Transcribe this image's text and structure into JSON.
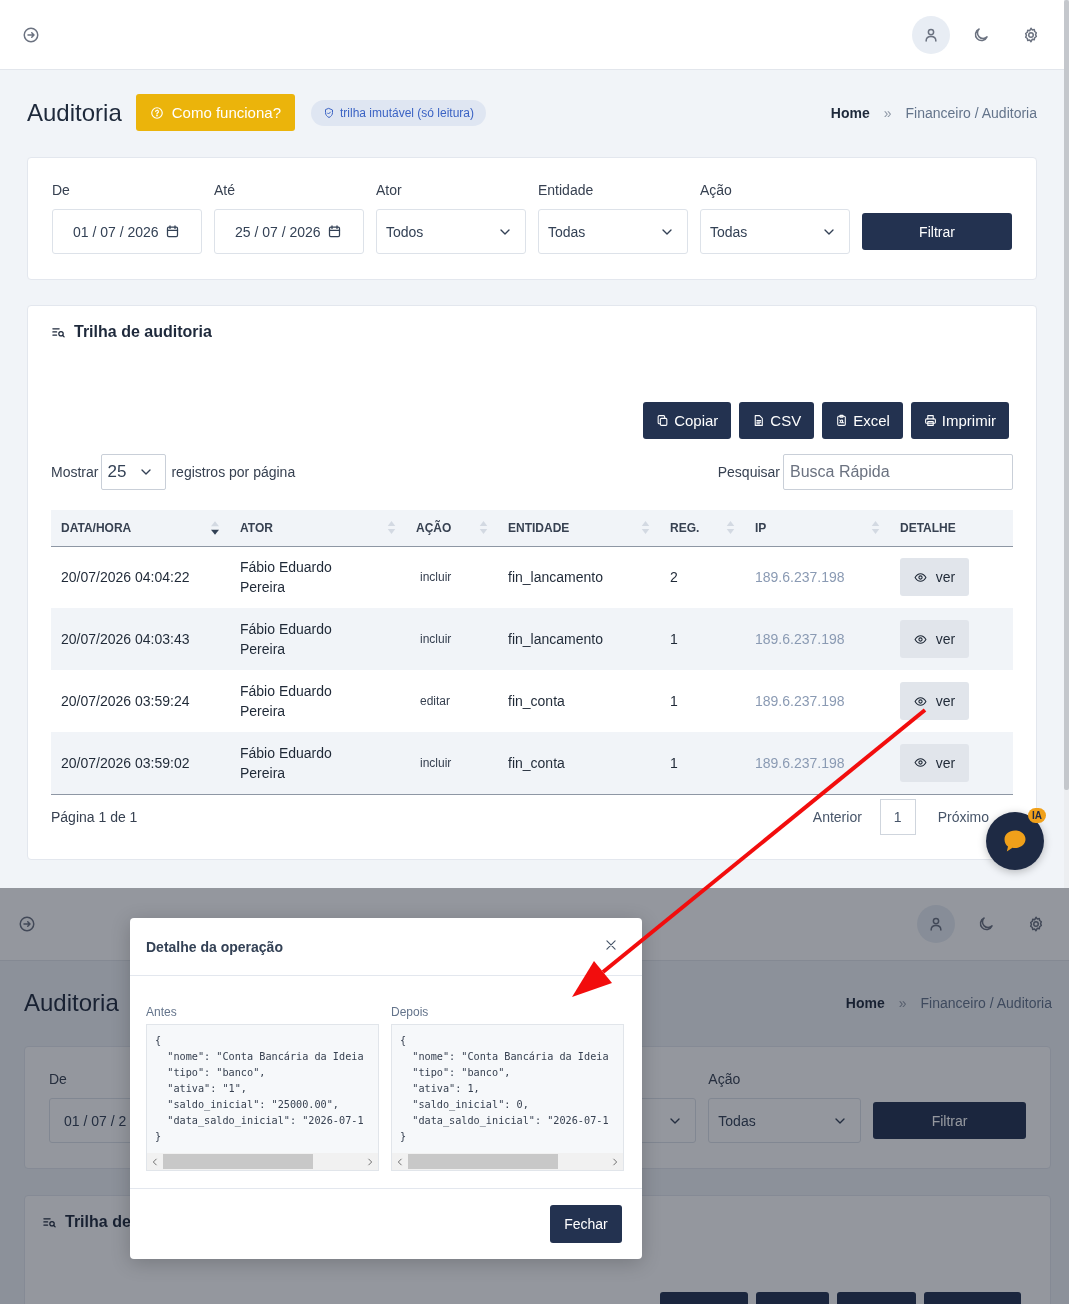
{
  "page": {
    "title": "Auditoria",
    "help_button": "Como funciona?",
    "badge": "trilha imutável (só leitura)",
    "breadcrumb": {
      "separator": "»",
      "items": [
        {
          "label": "Home",
          "current": false
        },
        {
          "label": "Financeiro / Auditoria",
          "current": true
        }
      ]
    }
  },
  "filters": {
    "fields": [
      {
        "label": "De",
        "kind": "date",
        "value": "01 / 07 / 2026"
      },
      {
        "label": "Até",
        "kind": "date",
        "value": "25 / 07 / 2026"
      },
      {
        "label": "Ator",
        "kind": "select",
        "value": "Todos"
      },
      {
        "label": "Entidade",
        "kind": "select",
        "value": "Todas"
      },
      {
        "label": "Ação",
        "kind": "select",
        "value": "Todas"
      }
    ],
    "button": "Filtrar"
  },
  "audit_card": {
    "title": "Trilha de auditoria",
    "export_buttons": [
      {
        "label": "Copiar",
        "kind": "copy"
      },
      {
        "label": "CSV",
        "kind": "file"
      },
      {
        "label": "Excel",
        "kind": "clipboard"
      },
      {
        "label": "Imprimir",
        "kind": "print"
      }
    ],
    "length": {
      "before": "Mostrar",
      "value": "25",
      "after": "registros por página"
    },
    "search": {
      "label": "Pesquisar",
      "placeholder": "Busca Rápida"
    },
    "table": {
      "columns": [
        {
          "label": "DATA/HORA",
          "sortable": true,
          "sorted": true
        },
        {
          "label": "ATOR",
          "sortable": true,
          "sorted": false
        },
        {
          "label": "AÇÃO",
          "sortable": true,
          "sorted": false
        },
        {
          "label": "ENTIDADE",
          "sortable": true,
          "sorted": false
        },
        {
          "label": "REG.",
          "sortable": true,
          "sorted": false
        },
        {
          "label": "IP",
          "sortable": true,
          "sorted": false
        },
        {
          "label": "DETALHE",
          "sortable": false,
          "sorted": false
        }
      ],
      "rows": [
        {
          "cells": [
            "20/07/2026 04:04:22",
            "Fábio Eduardo Pereira",
            "incluir",
            "fin_lancamento",
            "2",
            "189.6.237.198"
          ],
          "button": "ver"
        },
        {
          "cells": [
            "20/07/2026 04:03:43",
            "Fábio Eduardo Pereira",
            "incluir",
            "fin_lancamento",
            "1",
            "189.6.237.198"
          ],
          "button": "ver"
        },
        {
          "cells": [
            "20/07/2026 03:59:24",
            "Fábio Eduardo Pereira",
            "editar",
            "fin_conta",
            "1",
            "189.6.237.198"
          ],
          "button": "ver"
        },
        {
          "cells": [
            "20/07/2026 03:59:02",
            "Fábio Eduardo Pereira",
            "incluir",
            "fin_conta",
            "1",
            "189.6.237.198"
          ],
          "button": "ver"
        }
      ]
    },
    "pagination": {
      "info": "Página 1 de 1",
      "previous": "Anterior",
      "pages": [
        {
          "label": "1",
          "selected": true
        }
      ],
      "next": "Próximo"
    }
  },
  "chat": {
    "badge": "IA"
  },
  "second_capture": {
    "title": "Auditoria",
    "breadcrumb": {
      "separator": "»",
      "items": [
        {
          "label": "Home",
          "current": false
        },
        {
          "label": "Financeiro / Auditoria",
          "current": true
        }
      ]
    },
    "date_field": {
      "label": "De",
      "value": "01 / 07 / 2"
    },
    "action_field": {
      "label": "Ação",
      "value": "Todas"
    },
    "filter_button": "Filtrar",
    "card_title": "Trilha de",
    "modal": {
      "title": "Detalhe da operação",
      "close_button": "Fechar",
      "panes": [
        {
          "label": "Antes",
          "lines": [
            "{",
            "  \"nome\": \"Conta Bancária da Ideia",
            "  \"tipo\": \"banco\",",
            "  \"ativa\": \"1\",",
            "  \"saldo_inicial\": \"25000.00\",",
            "  \"data_saldo_inicial\": \"2026-07-1",
            "}"
          ]
        },
        {
          "label": "Depois",
          "lines": [
            "{",
            "  \"nome\": \"Conta Bancária da Ideia",
            "  \"tipo\": \"banco\",",
            "  \"ativa\": 1,",
            "  \"saldo_inicial\": 0,",
            "  \"data_saldo_inicial\": \"2026-07-1",
            "}"
          ]
        }
      ]
    }
  }
}
